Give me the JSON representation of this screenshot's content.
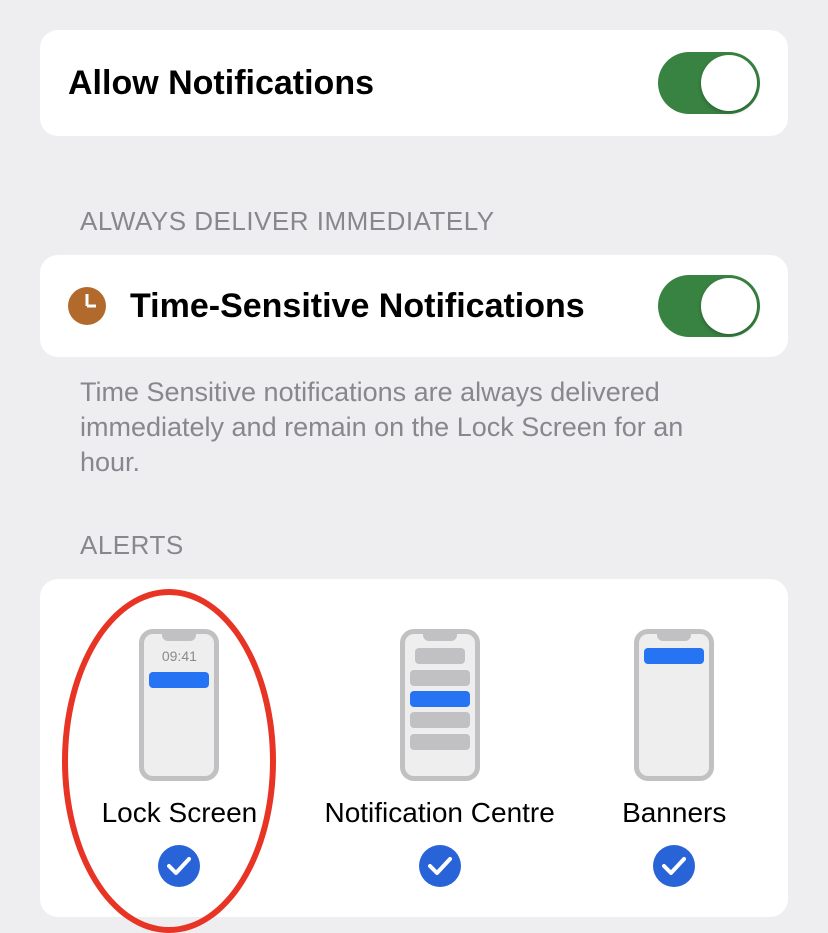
{
  "allow": {
    "title": "Allow Notifications",
    "enabled": true
  },
  "immediately": {
    "header": "ALWAYS DELIVER IMMEDIATELY",
    "item": {
      "title": "Time-Sensitive Notifications",
      "enabled": true
    },
    "footer": "Time Sensitive notifications are always delivered immediately and remain on the Lock Screen for an hour."
  },
  "alerts": {
    "header": "ALERTS",
    "options": [
      {
        "label": "Lock Screen",
        "checked": true,
        "highlighted": true,
        "time": "09:41"
      },
      {
        "label": "Notification Centre",
        "checked": true
      },
      {
        "label": "Banners",
        "checked": true
      }
    ]
  }
}
